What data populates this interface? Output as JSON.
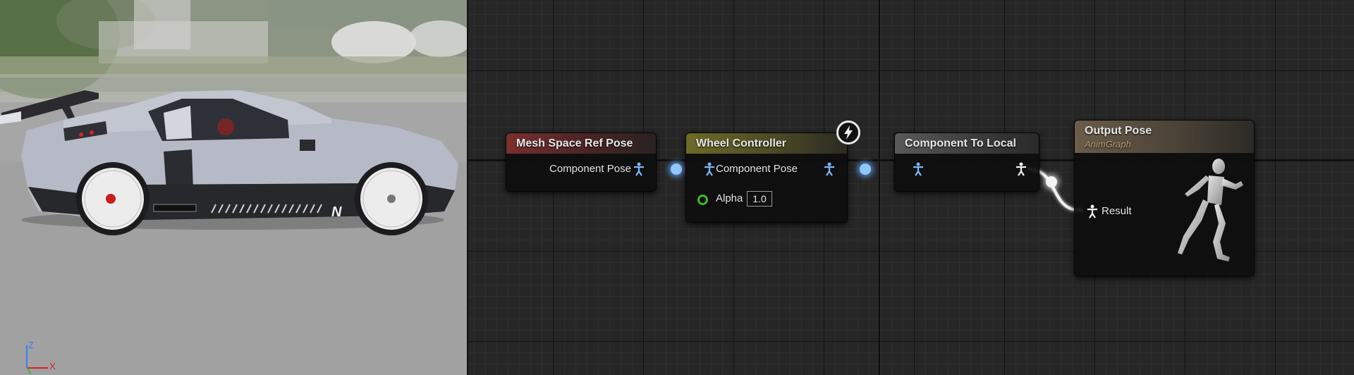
{
  "viewport": {
    "axis_labels": {
      "z": "Z",
      "x": "X"
    },
    "colors": {
      "axis_z": "#3a7bff",
      "axis_x": "#e02020",
      "car_body": "#b6bac6"
    }
  },
  "graph": {
    "nodes": [
      {
        "id": "mesh_space_ref_pose",
        "title": "Mesh Space Ref Pose",
        "header_color": "#7a2f30",
        "pins": [
          {
            "label": "Component Pose",
            "direction": "output"
          }
        ]
      },
      {
        "id": "wheel_controller",
        "title": "Wheel Controller",
        "header_color": "#6e6a26",
        "pins": [
          {
            "label": "Component Pose",
            "direction": "input"
          },
          {
            "label": "",
            "direction": "output"
          }
        ],
        "alpha": {
          "label": "Alpha",
          "value": "1.0"
        },
        "badge_icon": "lightning-bolt-icon"
      },
      {
        "id": "component_to_local",
        "title": "Component To Local",
        "header_color": "#5a5a5a",
        "pins": [
          {
            "label": "",
            "direction": "input"
          },
          {
            "label": "",
            "direction": "output"
          }
        ]
      },
      {
        "id": "output_pose",
        "title": "Output Pose",
        "subtitle": "AnimGraph",
        "header_color": "#6b5c4a",
        "pins": [
          {
            "label": "Result",
            "direction": "input"
          }
        ],
        "preview_icon": "running-mannequin-icon"
      }
    ],
    "wire_colors": {
      "component_space": "#7ab8ff",
      "local_space": "#ffffff"
    }
  }
}
